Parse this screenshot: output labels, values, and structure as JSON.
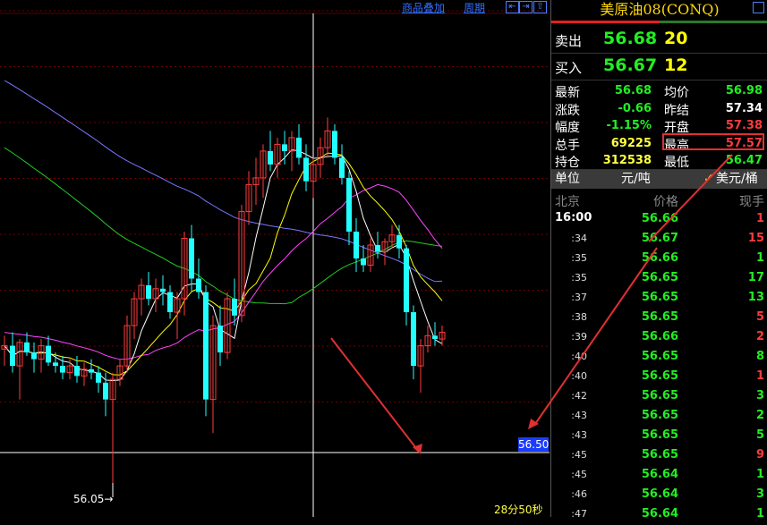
{
  "toolbar": {
    "overlay_label": "商品叠加",
    "period_label": "周期",
    "nav_left": "⇤",
    "nav_right": "⇥",
    "nav_up": "⇧"
  },
  "chart": {
    "price_tag": "56.50",
    "low_mark": "56.05",
    "low_arrow": "→",
    "countdown": "28分50秒"
  },
  "chart_data": {
    "type": "candlestick",
    "title": "",
    "current_price": 56.5,
    "marked_low": 56.05,
    "y_range": [
      55.95,
      57.45
    ],
    "x_range": [
      0,
      614
    ],
    "candles": [
      [
        5,
        56.45,
        56.49,
        56.4,
        56.46
      ],
      [
        14,
        56.46,
        56.5,
        56.38,
        56.4
      ],
      [
        22,
        56.4,
        56.48,
        56.3,
        56.47
      ],
      [
        30,
        56.47,
        56.5,
        56.43,
        56.44
      ],
      [
        38,
        56.44,
        56.47,
        56.38,
        56.42
      ],
      [
        46,
        56.42,
        56.48,
        56.38,
        56.46
      ],
      [
        54,
        56.46,
        56.49,
        56.4,
        56.41
      ],
      [
        62,
        56.41,
        56.44,
        56.38,
        56.4
      ],
      [
        70,
        56.4,
        56.43,
        56.36,
        56.38
      ],
      [
        78,
        56.38,
        56.42,
        56.36,
        56.4
      ],
      [
        86,
        56.4,
        56.43,
        56.35,
        56.37
      ],
      [
        94,
        56.37,
        56.41,
        56.34,
        56.39
      ],
      [
        102,
        56.39,
        56.42,
        56.36,
        56.38
      ],
      [
        110,
        56.38,
        56.4,
        56.32,
        56.35
      ],
      [
        118,
        56.35,
        56.38,
        56.25,
        56.3
      ],
      [
        126,
        56.3,
        56.38,
        56.05,
        56.36
      ],
      [
        134,
        56.36,
        56.42,
        56.34,
        56.4
      ],
      [
        142,
        56.4,
        56.55,
        56.38,
        56.52
      ],
      [
        150,
        56.52,
        56.62,
        56.48,
        56.6
      ],
      [
        158,
        56.6,
        56.66,
        56.55,
        56.64
      ],
      [
        166,
        56.64,
        56.68,
        56.58,
        56.6
      ],
      [
        174,
        56.6,
        56.66,
        56.56,
        56.63
      ],
      [
        182,
        56.63,
        56.67,
        56.58,
        56.62
      ],
      [
        190,
        56.62,
        56.64,
        56.54,
        56.56
      ],
      [
        198,
        56.56,
        56.62,
        56.48,
        56.6
      ],
      [
        206,
        56.6,
        56.8,
        56.55,
        56.78
      ],
      [
        214,
        56.78,
        56.82,
        56.62,
        56.66
      ],
      [
        222,
        56.66,
        56.72,
        56.6,
        56.62
      ],
      [
        230,
        56.62,
        56.64,
        56.25,
        56.3
      ],
      [
        238,
        56.3,
        56.55,
        56.2,
        56.52
      ],
      [
        246,
        56.52,
        56.58,
        56.4,
        56.44
      ],
      [
        254,
        56.44,
        56.62,
        56.42,
        56.6
      ],
      [
        262,
        56.6,
        56.66,
        56.52,
        56.55
      ],
      [
        270,
        56.55,
        56.88,
        56.53,
        56.86
      ],
      [
        278,
        56.86,
        56.98,
        56.82,
        56.94
      ],
      [
        286,
        56.94,
        57.02,
        56.88,
        56.96
      ],
      [
        294,
        56.96,
        57.06,
        56.9,
        57.04
      ],
      [
        302,
        57.04,
        57.1,
        56.98,
        57.0
      ],
      [
        310,
        57.0,
        57.08,
        56.96,
        57.06
      ],
      [
        318,
        57.06,
        57.1,
        57.0,
        57.04
      ],
      [
        326,
        57.04,
        57.1,
        56.98,
        57.08
      ],
      [
        334,
        57.08,
        57.12,
        57.0,
        57.02
      ],
      [
        342,
        57.02,
        57.06,
        56.92,
        56.95
      ],
      [
        350,
        56.95,
        57.02,
        56.9,
        57.0
      ],
      [
        358,
        57.0,
        57.08,
        56.96,
        57.05
      ],
      [
        366,
        57.05,
        57.14,
        57.02,
        57.1
      ],
      [
        374,
        57.1,
        57.12,
        57.0,
        57.02
      ],
      [
        382,
        57.02,
        57.06,
        56.94,
        56.96
      ],
      [
        390,
        56.96,
        56.98,
        56.76,
        56.8
      ],
      [
        398,
        56.8,
        56.84,
        56.68,
        56.72
      ],
      [
        406,
        56.72,
        56.76,
        56.68,
        56.7
      ],
      [
        414,
        56.7,
        56.78,
        56.68,
        56.76
      ],
      [
        422,
        56.76,
        56.8,
        56.72,
        56.74
      ],
      [
        430,
        56.74,
        56.78,
        56.7,
        56.77
      ],
      [
        438,
        56.77,
        56.82,
        56.75,
        56.79
      ],
      [
        446,
        56.79,
        56.82,
        56.72,
        56.75
      ],
      [
        454,
        56.75,
        56.76,
        56.52,
        56.56
      ],
      [
        462,
        56.56,
        56.58,
        56.36,
        56.4
      ],
      [
        470,
        56.4,
        56.48,
        56.32,
        56.46
      ],
      [
        478,
        56.46,
        56.52,
        56.44,
        56.49
      ],
      [
        486,
        56.49,
        56.53,
        56.46,
        56.48
      ],
      [
        494,
        56.48,
        56.52,
        56.46,
        56.5
      ]
    ]
  },
  "panel": {
    "title": "美原油08(CONQ)",
    "sell_label": "卖出",
    "sell_price": "56.68",
    "sell_vol": "20",
    "buy_label": "买入",
    "buy_price": "56.67",
    "buy_vol": "12",
    "stats": [
      {
        "l1": "最新",
        "v1": "56.68",
        "c1": "green",
        "l2": "均价",
        "v2": "56.98",
        "c2": "green"
      },
      {
        "l1": "涨跌",
        "v1": "-0.66",
        "c1": "green",
        "l2": "昨结",
        "v2": "57.34",
        "c2": "white"
      },
      {
        "l1": "幅度",
        "v1": "-1.15%",
        "c1": "green",
        "l2": "开盘",
        "v2": "57.38",
        "c2": "red"
      },
      {
        "l1": "总手",
        "v1": "69225",
        "c1": "yellow",
        "l2": "最高",
        "v2": "57.57",
        "c2": "red"
      },
      {
        "l1": "持仓",
        "v1": "312538",
        "c1": "yellow",
        "l2": "最低",
        "v2": "56.47",
        "c2": "green"
      }
    ],
    "unit_label": "单位",
    "unit_cny": "元/吨",
    "unit_usd_check": "✓",
    "unit_usd": "美元/桶",
    "tick_head_time": "北京",
    "tick_head_price": "价格",
    "tick_head_vol": "现手",
    "ticks": [
      {
        "t": "16:00",
        "p": "56.66",
        "v": "1",
        "c": "red"
      },
      {
        "t": ":34",
        "p": "56.67",
        "v": "15",
        "c": "red"
      },
      {
        "t": ":35",
        "p": "56.66",
        "v": "1",
        "c": "green"
      },
      {
        "t": ":35",
        "p": "56.65",
        "v": "17",
        "c": "green"
      },
      {
        "t": ":37",
        "p": "56.65",
        "v": "13",
        "c": "green"
      },
      {
        "t": ":38",
        "p": "56.65",
        "v": "5",
        "c": "red"
      },
      {
        "t": ":39",
        "p": "56.66",
        "v": "2",
        "c": "red"
      },
      {
        "t": ":40",
        "p": "56.65",
        "v": "8",
        "c": "green"
      },
      {
        "t": ":40",
        "p": "56.65",
        "v": "1",
        "c": "red"
      },
      {
        "t": ":42",
        "p": "56.65",
        "v": "3",
        "c": "green"
      },
      {
        "t": ":43",
        "p": "56.65",
        "v": "2",
        "c": "green"
      },
      {
        "t": ":43",
        "p": "56.65",
        "v": "5",
        "c": "green"
      },
      {
        "t": ":45",
        "p": "56.65",
        "v": "9",
        "c": "red"
      },
      {
        "t": ":45",
        "p": "56.64",
        "v": "1",
        "c": "green"
      },
      {
        "t": ":46",
        "p": "56.64",
        "v": "3",
        "c": "green"
      },
      {
        "t": ":47",
        "p": "56.64",
        "v": "1",
        "c": "green"
      }
    ]
  },
  "colors": {
    "up": "#ff3b3b",
    "down": "#22ffff",
    "grid": "#6b0000",
    "ma5": "#ffffff",
    "ma10": "#ffff00",
    "ma20": "#ff44ff",
    "ma40": "#22cc22",
    "ma60": "#7777ff"
  }
}
